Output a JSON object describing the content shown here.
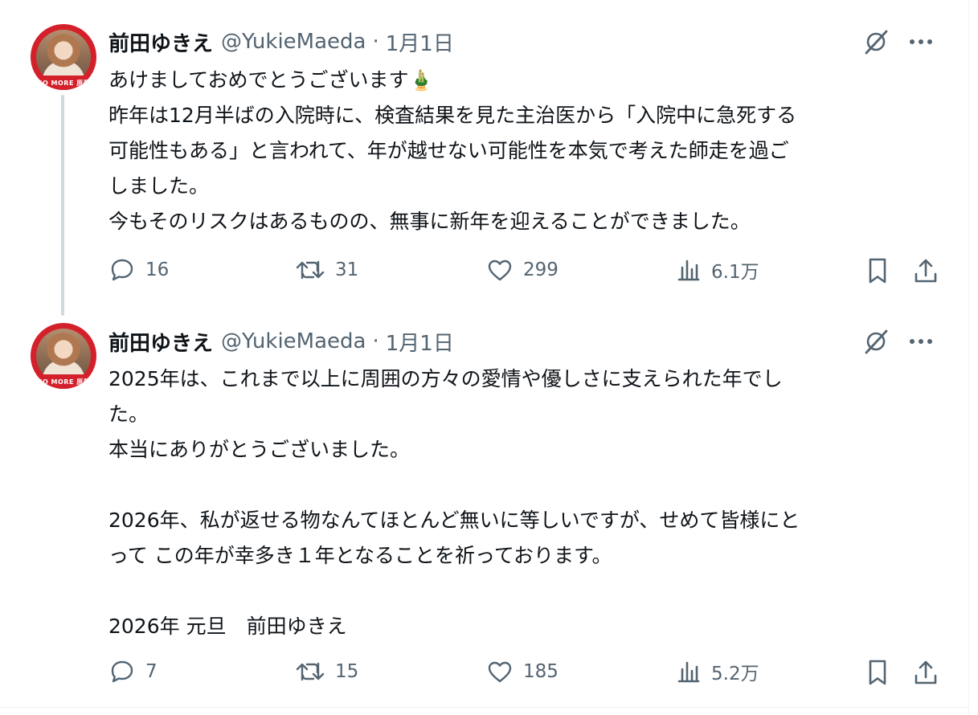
{
  "tweets": [
    {
      "author": "前田ゆきえ",
      "handle": "@YukieMaeda",
      "separator": "·",
      "date": "1月1日",
      "avatar_label": "NO MORE 原発",
      "lines": [
        "あけましておめでとうございます🎍",
        "昨年は12月半ばの入院時に、検査結果を見た主治医から「入院中に急死する",
        "可能性もある」と言われて、年が越せない可能性を本気で考えた師走を過ご",
        "しました。",
        "今もそのリスクはあるものの、無事に新年を迎えることができました。"
      ],
      "stats": {
        "replies": "16",
        "reposts": "31",
        "likes": "299",
        "views": "6.1万"
      }
    },
    {
      "author": "前田ゆきえ",
      "handle": "@YukieMaeda",
      "separator": "·",
      "date": "1月1日",
      "avatar_label": "NO MORE 原発",
      "lines": [
        "2025年は、これまで以上に周囲の方々の愛情や優しさに支えられた年でし",
        "た。",
        "本当にありがとうございました。",
        "",
        "2026年、私が返せる物なんてほとんど無いに等しいですが、せめて皆様にと",
        "って この年が幸多き１年となることを祈っております。",
        "",
        "2026年 元旦　前田ゆきえ"
      ],
      "stats": {
        "replies": "7",
        "reposts": "15",
        "likes": "185",
        "views": "5.2万"
      }
    }
  ],
  "icons": {
    "grok": "grok-icon",
    "more": "more-icon",
    "reply": "reply-icon",
    "repost": "repost-icon",
    "like": "like-icon",
    "views": "views-icon",
    "bookmark": "bookmark-icon",
    "share": "share-icon"
  },
  "colors": {
    "text": "#0f1419",
    "secondary": "#536471",
    "thread_line": "#cfd9de",
    "avatar_ring": "#d3202a"
  }
}
